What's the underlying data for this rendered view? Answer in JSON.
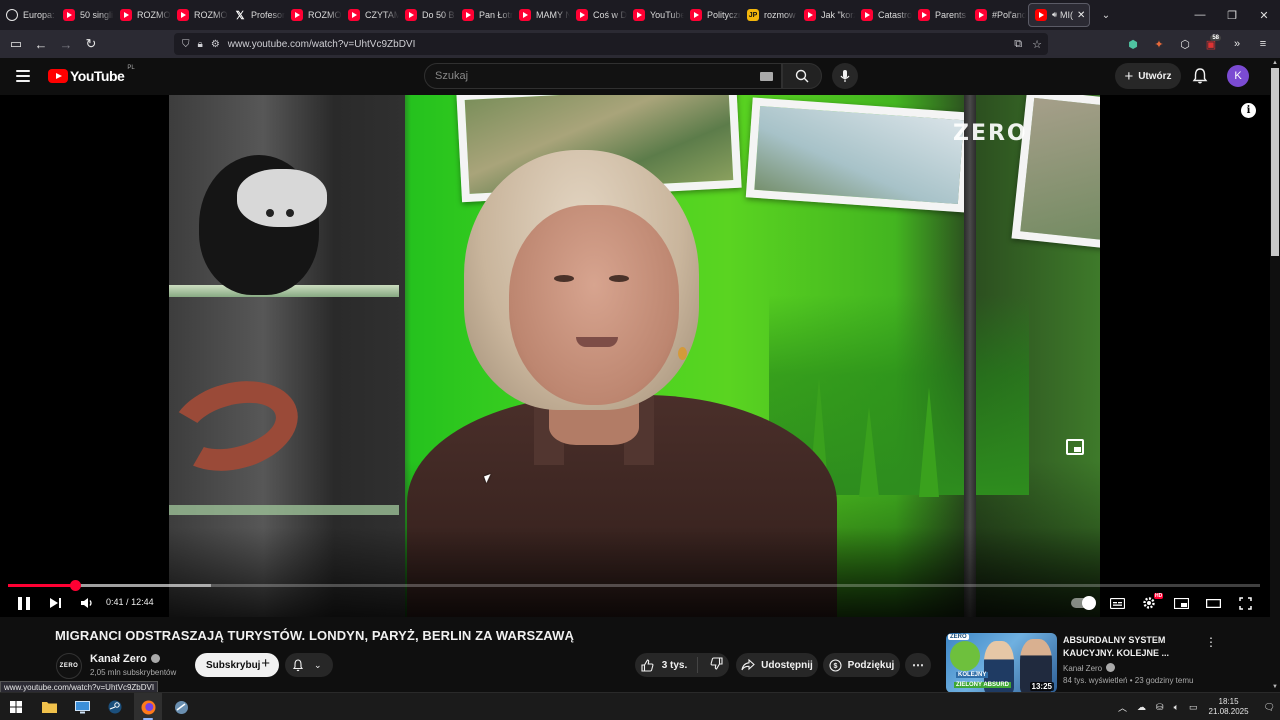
{
  "browser": {
    "tabs": [
      {
        "label": "Europa:",
        "icon": "globe-icon"
      },
      {
        "label": "50 singli",
        "icon": "youtube-icon"
      },
      {
        "label": "ROZMO",
        "icon": "youtube-icon"
      },
      {
        "label": "ROZMO",
        "icon": "youtube-icon"
      },
      {
        "label": "Profesor",
        "icon": "x-icon"
      },
      {
        "label": "ROZMO",
        "icon": "youtube-icon"
      },
      {
        "label": "CZYTAM",
        "icon": "youtube-icon"
      },
      {
        "label": "Do 50 B",
        "icon": "youtube-icon"
      },
      {
        "label": "Pan Łotr",
        "icon": "youtube-icon"
      },
      {
        "label": "MAMY N",
        "icon": "youtube-icon"
      },
      {
        "label": "Coś w D",
        "icon": "youtube-icon"
      },
      {
        "label": "YouTube",
        "icon": "youtube-icon"
      },
      {
        "label": "Polityczn",
        "icon": "youtube-icon"
      },
      {
        "label": "rozmow",
        "icon": "jp-icon"
      },
      {
        "label": "Jak \"korz",
        "icon": "youtube-icon"
      },
      {
        "label": "Catastro",
        "icon": "youtube-icon"
      },
      {
        "label": "Parents I",
        "icon": "youtube-icon"
      },
      {
        "label": "#Pol'and",
        "icon": "youtube-icon"
      }
    ],
    "active_tab": {
      "label": "MI(",
      "icon": "youtube-icon"
    },
    "url": "www.youtube.com/watch?v=UhtVc9ZbDVI",
    "extension_badge": "58",
    "status_url": "www.youtube.com/watch?v=UhtVc9ZbDVI"
  },
  "youtube": {
    "logo_text": "YouTube",
    "region": "PL",
    "search_placeholder": "Szukaj",
    "create_label": "Utwórz",
    "avatar_letter": "K"
  },
  "player": {
    "channel_watermark": "ZERO",
    "time_current": "0:41",
    "time_separator": "/",
    "time_total": "12:44",
    "progress_fraction": 0.0537,
    "buffer_fraction": 0.162,
    "settings_badge": "HD",
    "info_glyph": "i"
  },
  "video": {
    "title": "MIGRANCI ODSTRASZAJĄ TURYSTÓW. LONDYN, PARYŻ, BERLIN ZA WARSZAWĄ",
    "channel_avatar_text": "ZERO",
    "channel_name": "Kanał Zero",
    "subscribers": "2,05 mln subskrybentów",
    "subscribe_label": "Subskrybuj",
    "likes": "3 tys.",
    "share_label": "Udostępnij",
    "thanks_label": "Podziękuj"
  },
  "recommendation": {
    "title": "ABSURDALNY SYSTEM KAUCYJNY. KOLEJNE ...",
    "channel": "Kanał Zero",
    "views": "84 tys. wyświetleń",
    "separator": "•",
    "age": "23 godziny temu",
    "duration": "13:25",
    "thumb_tag_top": "ZERO",
    "thumb_tag_mid": "KOLEJNY",
    "thumb_tag_bottom": "ZIELONY ABSURD"
  },
  "taskbar": {
    "time": "18:15",
    "date": "21.08.2025"
  },
  "colors": {
    "youtube_red": "#ff0033",
    "background": "#0f0f0f",
    "browser_chrome": "#2b2a33"
  }
}
